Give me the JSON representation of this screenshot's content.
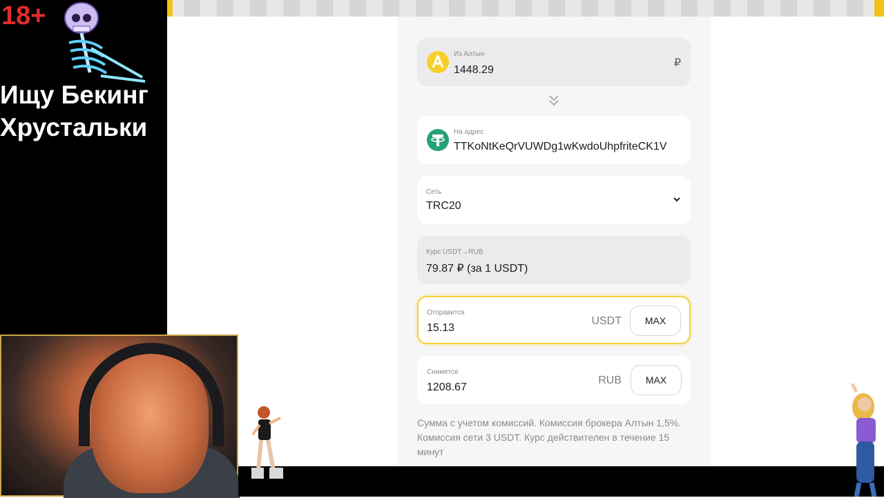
{
  "stream_overlay": {
    "age_badge": "18+",
    "title_line1": "Ищу Бекинг",
    "title_line2": "Хрустальки"
  },
  "exchange": {
    "from": {
      "label": "Из Алтын",
      "amount": "1448.29",
      "currency_symbol": "₽",
      "icon": "altyn-coin-icon",
      "icon_color": "#f6cf2a"
    },
    "swap_icon": "double-chevron-down-icon",
    "to": {
      "label": "На адрес",
      "address": "TTKoNtKeQrVUWDg1wKwdoUhpfriteCK1V",
      "icon": "tether-coin-icon",
      "icon_color": "#26a17b"
    },
    "network": {
      "label": "Сеть",
      "value": "TRC20",
      "icon": "chevron-down-icon"
    },
    "rate": {
      "label": "Курс USDT→RUB",
      "value": "79.87 ₽ (за 1 USDT)"
    },
    "send": {
      "label": "Отправится",
      "amount": "15.13",
      "unit": "USDT",
      "max_label": "MAX"
    },
    "debit": {
      "label": "Снимется",
      "amount": "1208.67",
      "unit": "RUB",
      "max_label": "MAX"
    },
    "note": "Сумма с учетом комиссий. Комиссия брокера Алтын 1,5%. Комиссия сети 3 USDT. Курс действителен в течение 15 минут"
  },
  "colors": {
    "accent_yellow": "#f6cf3b",
    "tether_green": "#26a17b",
    "card_gray": "#ebebed"
  }
}
